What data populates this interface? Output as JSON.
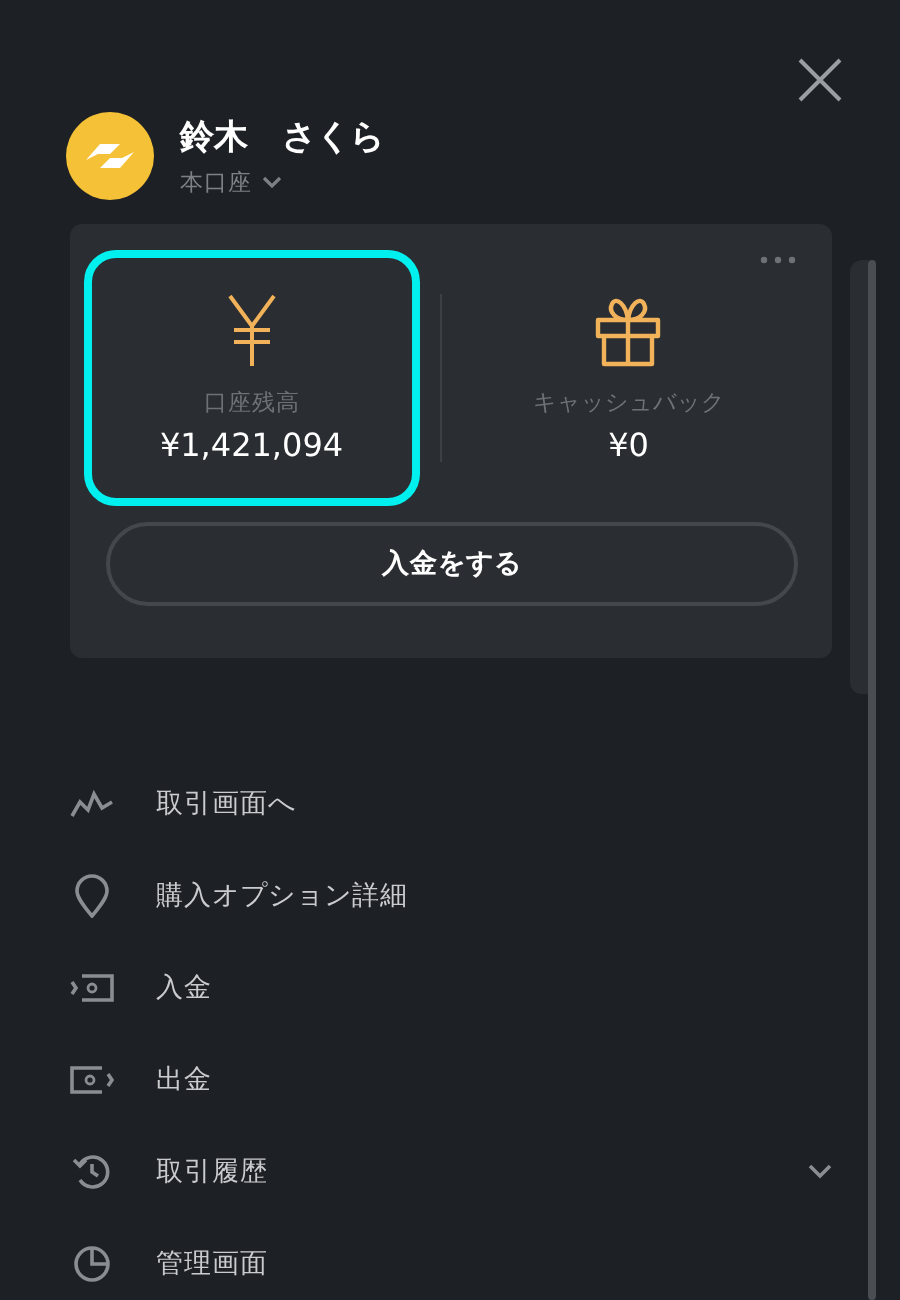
{
  "header": {
    "name": "鈴木　さくら",
    "account": "本口座"
  },
  "wallet": {
    "tiles": [
      {
        "kind": "balance",
        "label": "口座残高",
        "amount": "¥1,421,094",
        "highlighted": true
      },
      {
        "kind": "cashback",
        "label": "キャッシュバック",
        "amount": "¥0",
        "highlighted": false
      }
    ],
    "button": "入金をする"
  },
  "menu": [
    {
      "kind": "chart",
      "label": "取引画面へ"
    },
    {
      "kind": "pin",
      "label": "購入オプション詳細"
    },
    {
      "kind": "deposit",
      "label": "入金"
    },
    {
      "kind": "withdraw",
      "label": "出金"
    },
    {
      "kind": "history",
      "label": "取引履歴",
      "expanded": false
    },
    {
      "kind": "clock",
      "label": "管理画面"
    }
  ]
}
